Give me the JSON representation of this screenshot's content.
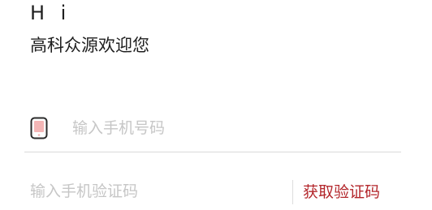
{
  "header": {
    "greeting": "H i",
    "welcome": "高科众源欢迎您"
  },
  "phone_field": {
    "icon": "phone-icon",
    "placeholder": "输入手机号码",
    "value": ""
  },
  "code_field": {
    "placeholder": "输入手机验证码",
    "value": "",
    "get_code_label": "获取验证码"
  },
  "colors": {
    "accent": "#b3262b",
    "icon_fill": "#f4b6b6",
    "icon_stroke": "#2b2b2b",
    "placeholder": "#c6c6c6",
    "divider": "#d9d9d9"
  }
}
